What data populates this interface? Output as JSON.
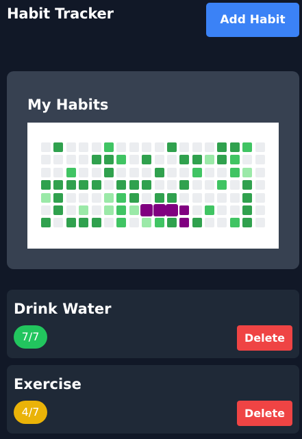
{
  "app": {
    "title": "Habit Tracker",
    "add_button_label": "Add Habit"
  },
  "panel": {
    "title": "My Habits",
    "grid_rows": [
      [
        0,
        3,
        0,
        0,
        0,
        2,
        0,
        0,
        0,
        0,
        3,
        0,
        0,
        0,
        3,
        3,
        2,
        0
      ],
      [
        0,
        0,
        0,
        0,
        3,
        3,
        2,
        0,
        3,
        0,
        0,
        3,
        3,
        1,
        3,
        2,
        0,
        0
      ],
      [
        0,
        0,
        2,
        0,
        0,
        3,
        0,
        0,
        0,
        3,
        0,
        0,
        2,
        0,
        0,
        2,
        1,
        0
      ],
      [
        3,
        3,
        3,
        3,
        3,
        0,
        3,
        3,
        3,
        0,
        0,
        3,
        0,
        0,
        2,
        0,
        3,
        0
      ],
      [
        1,
        3,
        0,
        0,
        0,
        1,
        2,
        3,
        0,
        3,
        3,
        0,
        0,
        0,
        0,
        0,
        3,
        0
      ],
      [
        0,
        3,
        0,
        1,
        0,
        1,
        2,
        1,
        "H",
        "H",
        "H",
        "h",
        0,
        2,
        0,
        0,
        3,
        0
      ],
      [
        3,
        0,
        3,
        3,
        3,
        0,
        2,
        0,
        1,
        2,
        3,
        "h",
        3,
        0,
        0,
        2,
        3,
        0
      ]
    ]
  },
  "habits": [
    {
      "name": "Drink Water",
      "progress": "7/7",
      "status": "full",
      "delete_label": "Delete"
    },
    {
      "name": "Exercise",
      "progress": "4/7",
      "status": "partial",
      "delete_label": "Delete"
    }
  ]
}
